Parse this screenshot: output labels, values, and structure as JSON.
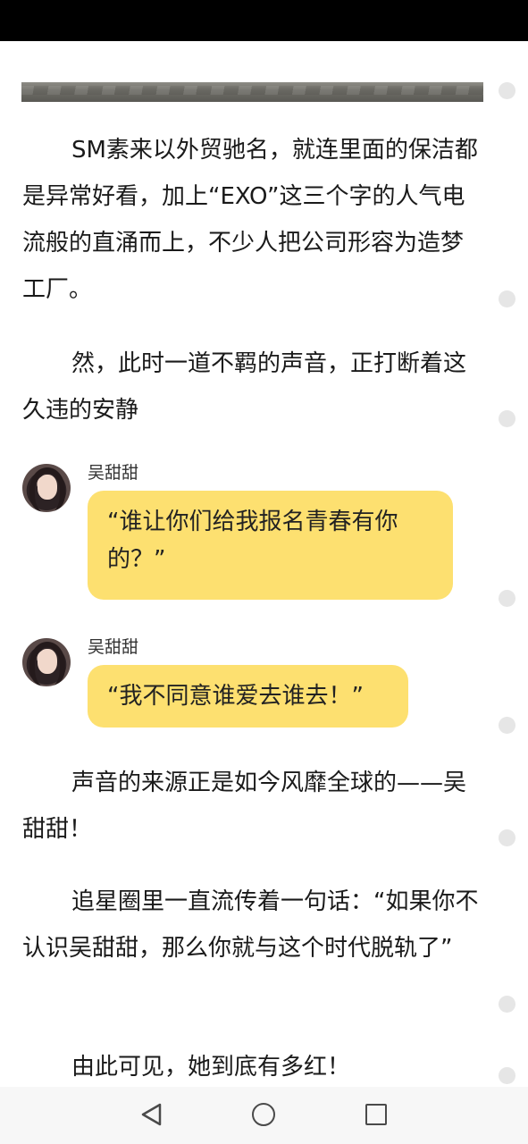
{
  "paragraphs": [
    "SM素来以外贸驰名，就连里面的保洁都是异常好看，加上“EXO”这三个字的人气电流般的直涌而上，不少人把公司形容为造梦工厂。",
    "然，此时一道不羁的声音，正打断着这久违的安静",
    "声音的来源正是如今风靡全球的——吴甜甜！",
    "追星圈里一直流传着一句话：“如果你不认识吴甜甜，那么你就与这个时代脱轨了”",
    "由此可见，她到底有多红！"
  ],
  "chat": [
    {
      "speaker": "吴甜甜",
      "message": "“谁让你们给我报名青春有你的？”"
    },
    {
      "speaker": "吴甜甜",
      "message": "“我不同意谁爱去谁去！”"
    }
  ],
  "nav": {
    "back_icon": "back-triangle-icon",
    "home_icon": "home-circle-icon",
    "recent_icon": "recent-apps-square-icon"
  }
}
